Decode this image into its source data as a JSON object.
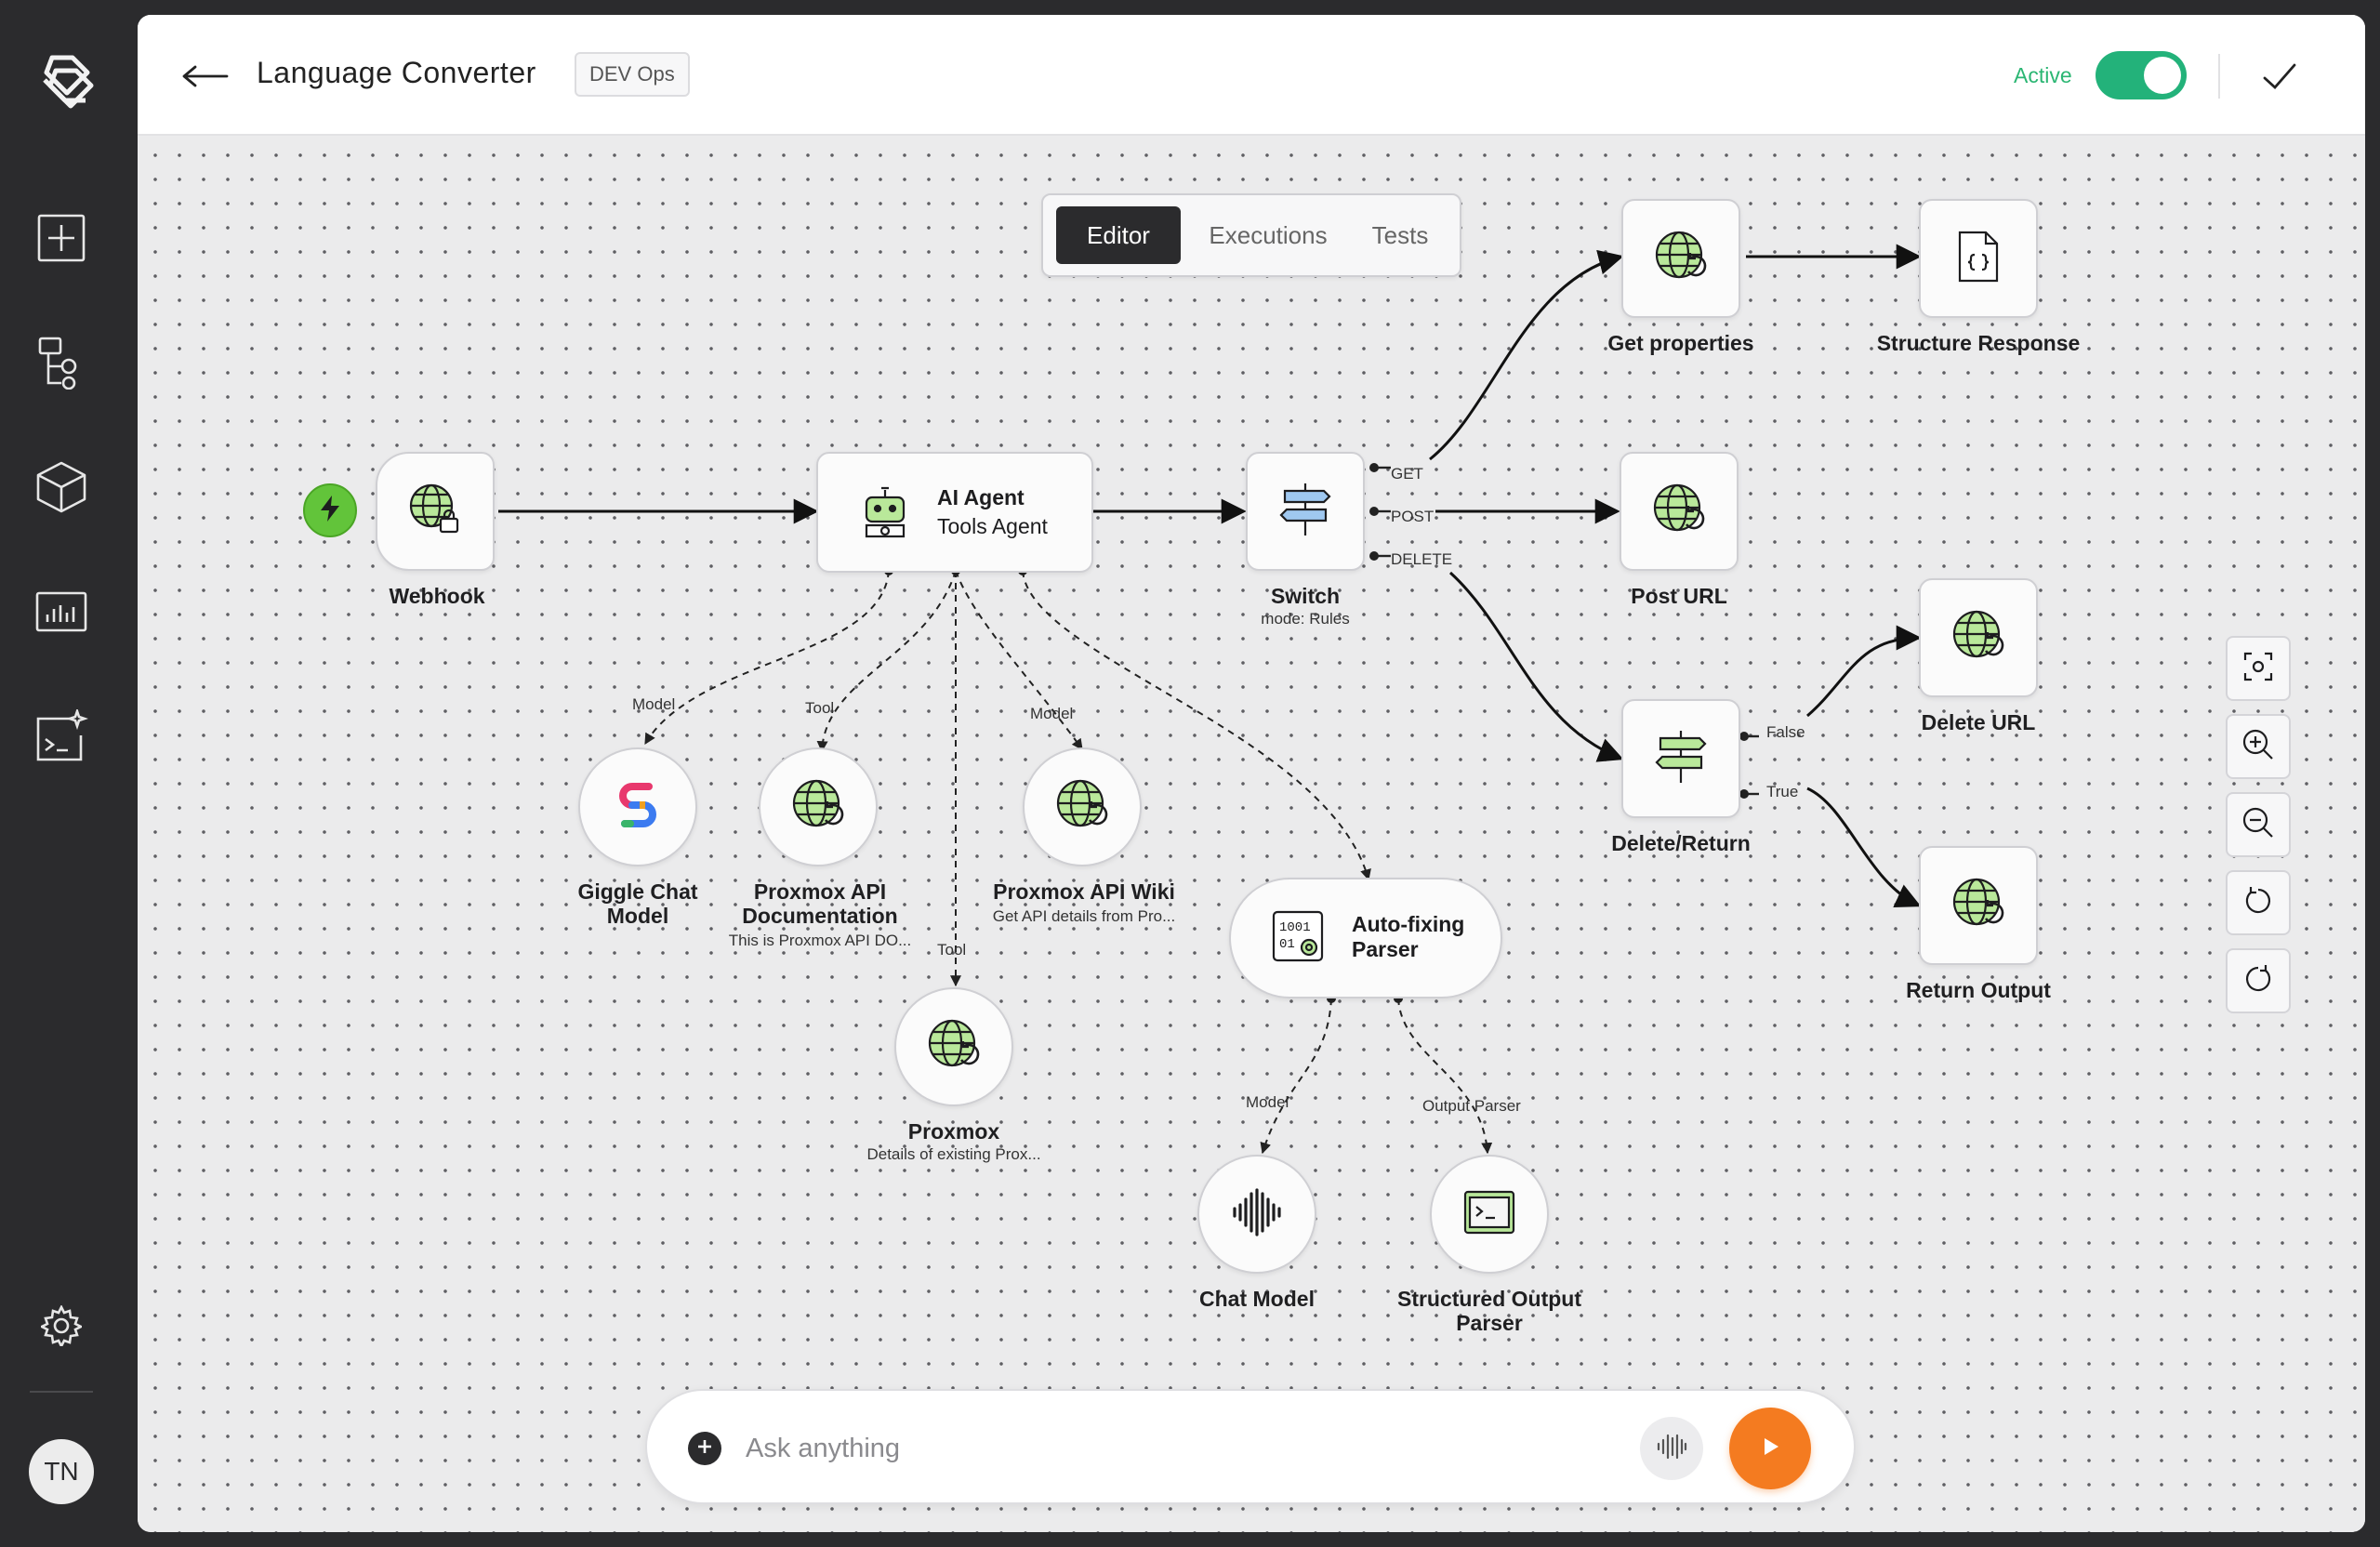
{
  "sidebar": {
    "items": [
      {
        "name": "new-workflow",
        "icon": "plus-square-icon"
      },
      {
        "name": "workflows",
        "icon": "tree-structure-icon"
      },
      {
        "name": "packages",
        "icon": "cube-icon"
      },
      {
        "name": "analytics",
        "icon": "bar-chart-icon"
      },
      {
        "name": "ai-terminal",
        "icon": "terminal-sparkle-icon"
      }
    ],
    "settings_icon": "gear-icon",
    "avatar_initials": "TN"
  },
  "header": {
    "title": "Language Converter",
    "tag": "DEV Ops",
    "status_label": "Active",
    "active": true,
    "accent": "#23b27a"
  },
  "tabs": [
    {
      "label": "Editor",
      "selected": true
    },
    {
      "label": "Executions",
      "selected": false
    },
    {
      "label": "Tests",
      "selected": false
    }
  ],
  "nodes": {
    "webhook": {
      "label": "Webhook"
    },
    "agent": {
      "title": "AI Agent",
      "subtitle": "Tools Agent"
    },
    "switch": {
      "label": "Switch",
      "sub": "mode: Rules"
    },
    "get_properties": {
      "label": "Get properties"
    },
    "structure_response": {
      "label": "Structure Response"
    },
    "post_url": {
      "label": "Post URL"
    },
    "delete_return": {
      "label": "Delete/Return"
    },
    "delete_url": {
      "label": "Delete URL"
    },
    "return_output": {
      "label": "Return Output"
    },
    "giggle": {
      "label1": "Giggle Chat",
      "label2": "Model"
    },
    "proxmox_api_doc": {
      "label1": "Proxmox API",
      "label2": "Documentation",
      "sub": "This is Proxmox API DO..."
    },
    "proxmox_wiki": {
      "label": "Proxmox API Wiki",
      "sub": "Get API details from Pro..."
    },
    "proxmox": {
      "label": "Proxmox",
      "sub": "Details of existing Prox..."
    },
    "auto_parser": {
      "label1": "Auto-fixing",
      "label2": "Parser"
    },
    "chat_model": {
      "label": "Chat Model"
    },
    "structured_parser": {
      "label1": "Structured Output",
      "label2": "Parser"
    }
  },
  "edge_labels": {
    "get": "GET",
    "post": "POST",
    "delete": "DELETE",
    "false": "False",
    "true": "True",
    "model1": "Model",
    "tool1": "Tool",
    "model2": "Model",
    "tool2": "Tool",
    "model3": "Model",
    "output_parser": "Output Parser"
  },
  "zoom_controls": [
    "fit-view-icon",
    "zoom-in-icon",
    "zoom-out-icon",
    "undo-icon",
    "redo-icon"
  ],
  "chat": {
    "placeholder": "Ask anything",
    "send_color": "#f47b20"
  },
  "colors": {
    "trigger": "#62c43a",
    "globe_fill": "#b9e89a",
    "toggle_on": "#23b27a"
  }
}
